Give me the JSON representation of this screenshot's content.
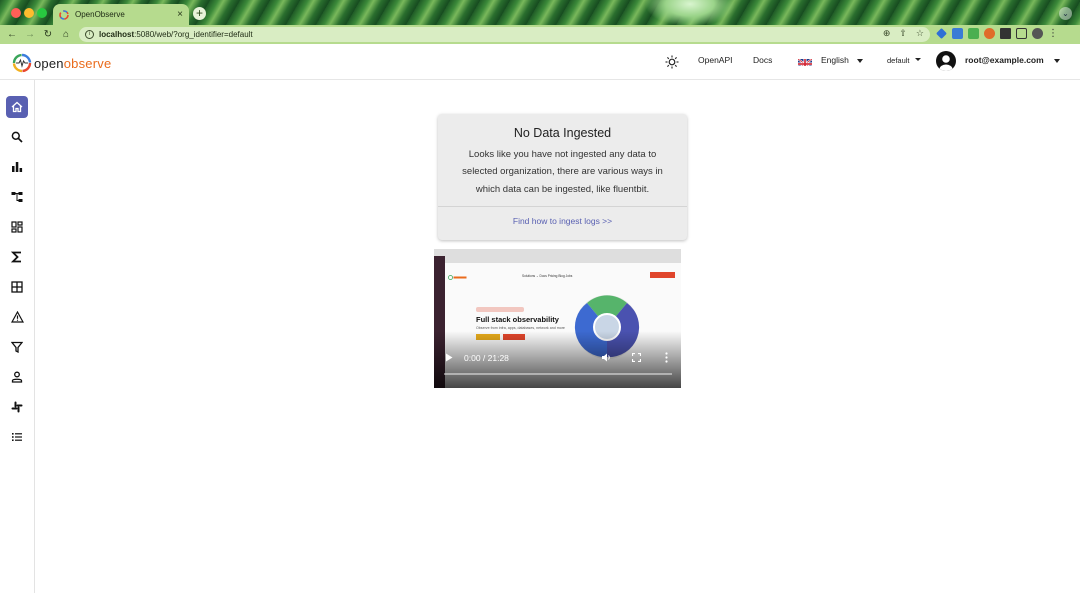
{
  "browser": {
    "tab_title": "OpenObserve",
    "tab_close": "×",
    "new_tab": "+",
    "url_host": "localhost",
    "url_rest": ":5080/web/?org_identifier=default",
    "icons": [
      "back-arrow-icon",
      "forward-arrow-icon",
      "reload-icon",
      "home-icon",
      "site-info-icon",
      "zoom-icon",
      "share-icon",
      "bookmark-star-icon",
      "extensions-icon",
      "sidepanel-icon",
      "profile-icon",
      "chrome-menu-icon"
    ]
  },
  "header": {
    "logo_open": "open",
    "logo_observe": "observe",
    "openapi": "OpenAPI",
    "docs": "Docs",
    "language": "English",
    "org": "default",
    "user": "root@example.com"
  },
  "sidebar": {
    "items": [
      {
        "name": "home",
        "icon": "home-icon",
        "active": true
      },
      {
        "name": "logs",
        "icon": "search-icon"
      },
      {
        "name": "metrics",
        "icon": "bar-chart-icon"
      },
      {
        "name": "traces",
        "icon": "account-tree-icon"
      },
      {
        "name": "dashboards",
        "icon": "dashboard-icon"
      },
      {
        "name": "functions",
        "icon": "sigma-icon"
      },
      {
        "name": "streams",
        "icon": "grid-icon"
      },
      {
        "name": "alerts",
        "icon": "warning-icon"
      },
      {
        "name": "ingestion",
        "icon": "filter-icon"
      },
      {
        "name": "iam",
        "icon": "person-icon"
      },
      {
        "name": "slack",
        "icon": "slack-icon"
      },
      {
        "name": "about",
        "icon": "list-icon"
      }
    ]
  },
  "main": {
    "card_title": "No Data Ingested",
    "card_lines": [
      "Looks like you have not ingested any data to",
      "selected organization, there are various ways in",
      "which data can be ingested, like fluentbit."
    ],
    "card_link": "Find how to ingest logs >>",
    "video": {
      "time": "0:00 / 21:28",
      "progress": 0,
      "frame_heading": "Full stack observability",
      "frame_sub": "Observe from infra, apps, databases, network and more",
      "frame_nav": "Solutions ⌄   Docs   Pricing   Blog   Jobs"
    }
  },
  "colors": {
    "accent": "#5960b2",
    "brand_orange": "#ea6b1c",
    "tab_green": "#b6db8e"
  }
}
